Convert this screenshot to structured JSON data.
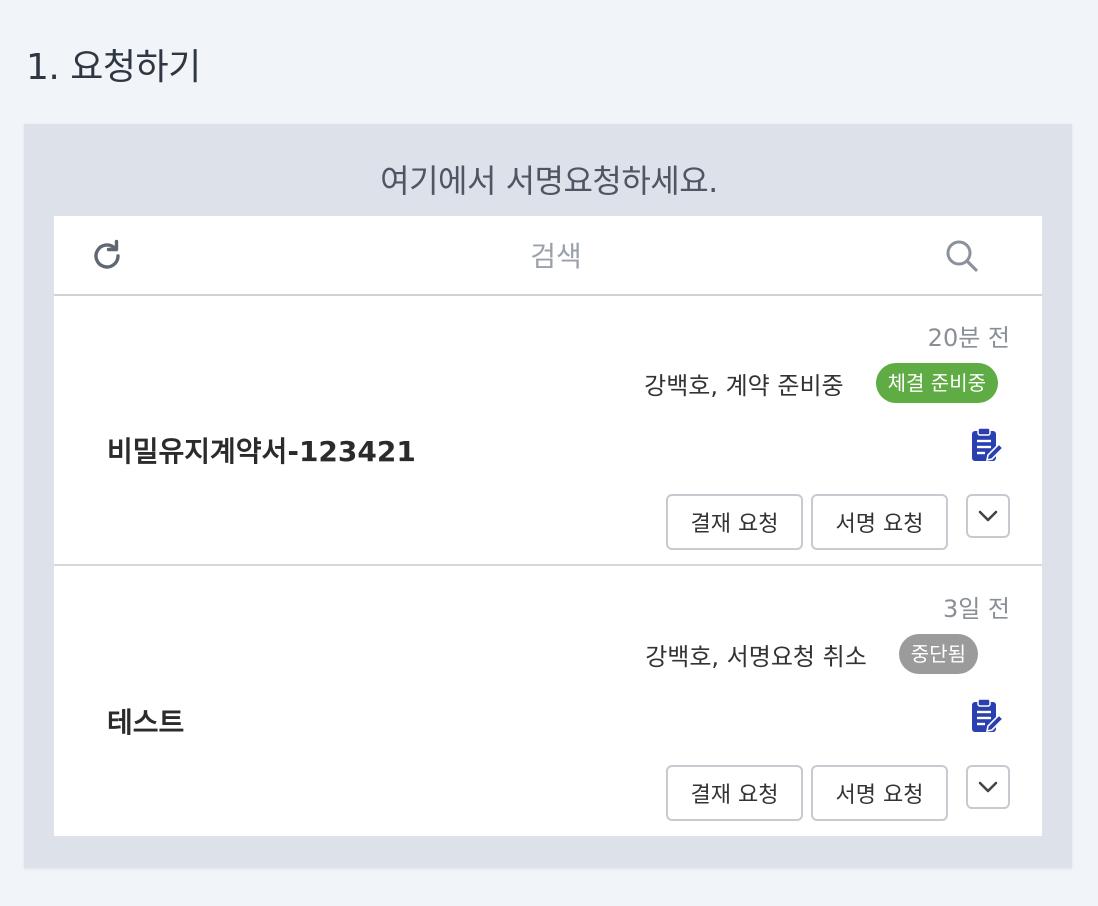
{
  "page": {
    "title": "1. 요청하기"
  },
  "panel": {
    "caption": "여기에서 서명요청하세요."
  },
  "toolbar": {
    "search_placeholder": "검색"
  },
  "colors": {
    "badge_green": "#5fac44",
    "badge_gray": "#9b9b9b",
    "doc_icon": "#2a3fb0"
  },
  "items": [
    {
      "time": "20분 전",
      "status": "강백호, 계약 준비중",
      "badge": "체결 준비중",
      "title": "비밀유지계약서-123421",
      "approve_label": "결재 요청",
      "sign_label": "서명 요청"
    },
    {
      "time": "3일 전",
      "status": "강백호, 서명요청 취소",
      "badge": "중단됨",
      "title": "테스트",
      "approve_label": "결재 요청",
      "sign_label": "서명 요청"
    }
  ]
}
